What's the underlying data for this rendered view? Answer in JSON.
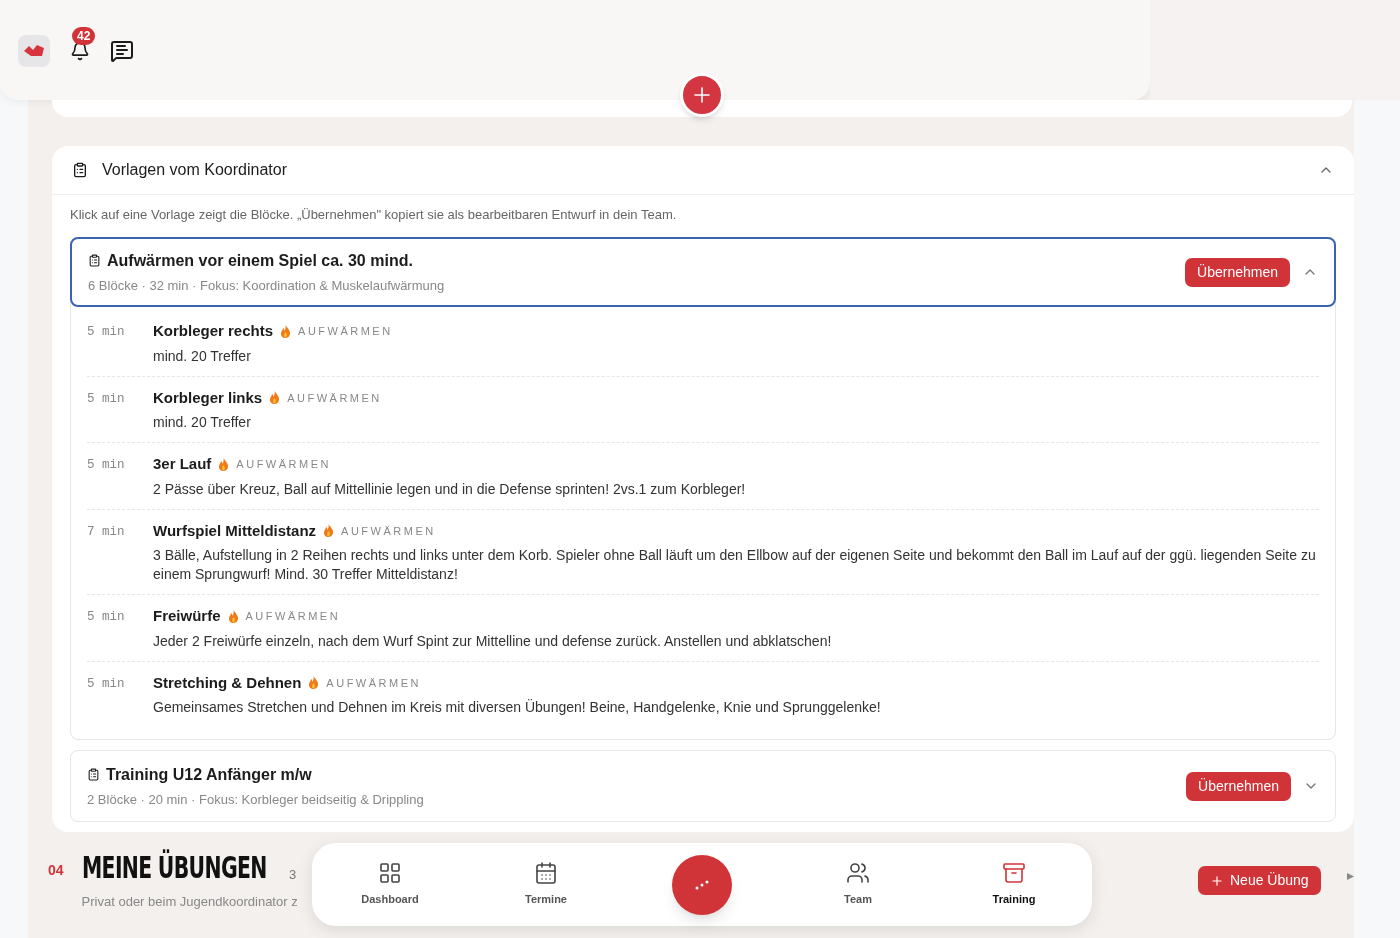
{
  "header": {
    "notification_count": "42"
  },
  "section": {
    "title": "Vorlagen vom Koordinator",
    "expanded": true,
    "description": "Klick auf eine Vorlage zeigt die Blöcke. „Übernehmen\" kopiert sie als bearbeitbaren Entwurf in dein Team.",
    "templates": [
      {
        "title": "Aufwärmen vor einem Spiel ca. 30 mind.",
        "meta": "6 Blöcke · 32 min · Fokus: Koordination & Muskelaufwärmung",
        "button": "Übernehmen",
        "expanded": true,
        "blocks": [
          {
            "duration": "5 min",
            "name": "Korbleger rechts",
            "category": "AUFWÄRMEN",
            "description": "mind. 20 Treffer"
          },
          {
            "duration": "5 min",
            "name": "Korbleger links",
            "category": "AUFWÄRMEN",
            "description": "mind. 20 Treffer"
          },
          {
            "duration": "5 min",
            "name": "3er Lauf",
            "category": "AUFWÄRMEN",
            "description": "2 Pässe über Kreuz, Ball auf Mittellinie legen und in die Defense sprinten! 2vs.1 zum Korbleger!"
          },
          {
            "duration": "7 min",
            "name": "Wurfspiel Mitteldistanz",
            "category": "AUFWÄRMEN",
            "description": "3 Bälle, Aufstellung in 2 Reihen rechts und links unter dem Korb. Spieler ohne Ball läuft um den Ellbow auf der eigenen Seite und bekommt den Ball im Lauf auf der ggü. liegenden Seite zu einem Sprungwurf! Mind. 30 Treffer Mitteldistanz!"
          },
          {
            "duration": "5 min",
            "name": "Freiwürfe",
            "category": "AUFWÄRMEN",
            "description": "Jeder 2 Freiwürfe einzeln, nach dem Wurf Spint zur Mittelline und defense zurück. Anstellen und abklatschen!"
          },
          {
            "duration": "5 min",
            "name": "Stretching & Dehnen",
            "category": "AUFWÄRMEN",
            "description": "Gemeinsames Stretchen und Dehnen im Kreis mit diversen Übungen! Beine, Handgelenke, Knie und Sprunggelenke!"
          }
        ]
      },
      {
        "title": "Training U12 Anfänger m/w",
        "meta": "2 Blöcke · 20 min · Fokus: Korbleger beidseitig & Drippling",
        "button": "Übernehmen",
        "expanded": false
      }
    ]
  },
  "exercises": {
    "number": "04",
    "title": "MEINE ÜBUNGEN",
    "count": "3",
    "subtitle": "Privat oder beim Jugendkoordinator z",
    "button": "Neue Übung"
  },
  "nav": [
    {
      "kind": "dashboard",
      "label": "Dashboard",
      "selected": false
    },
    {
      "kind": "calendar",
      "label": "Termine",
      "selected": false
    },
    {
      "kind": "fab"
    },
    {
      "kind": "team",
      "label": "Team",
      "selected": false
    },
    {
      "kind": "training",
      "label": "Training",
      "selected": true
    }
  ]
}
